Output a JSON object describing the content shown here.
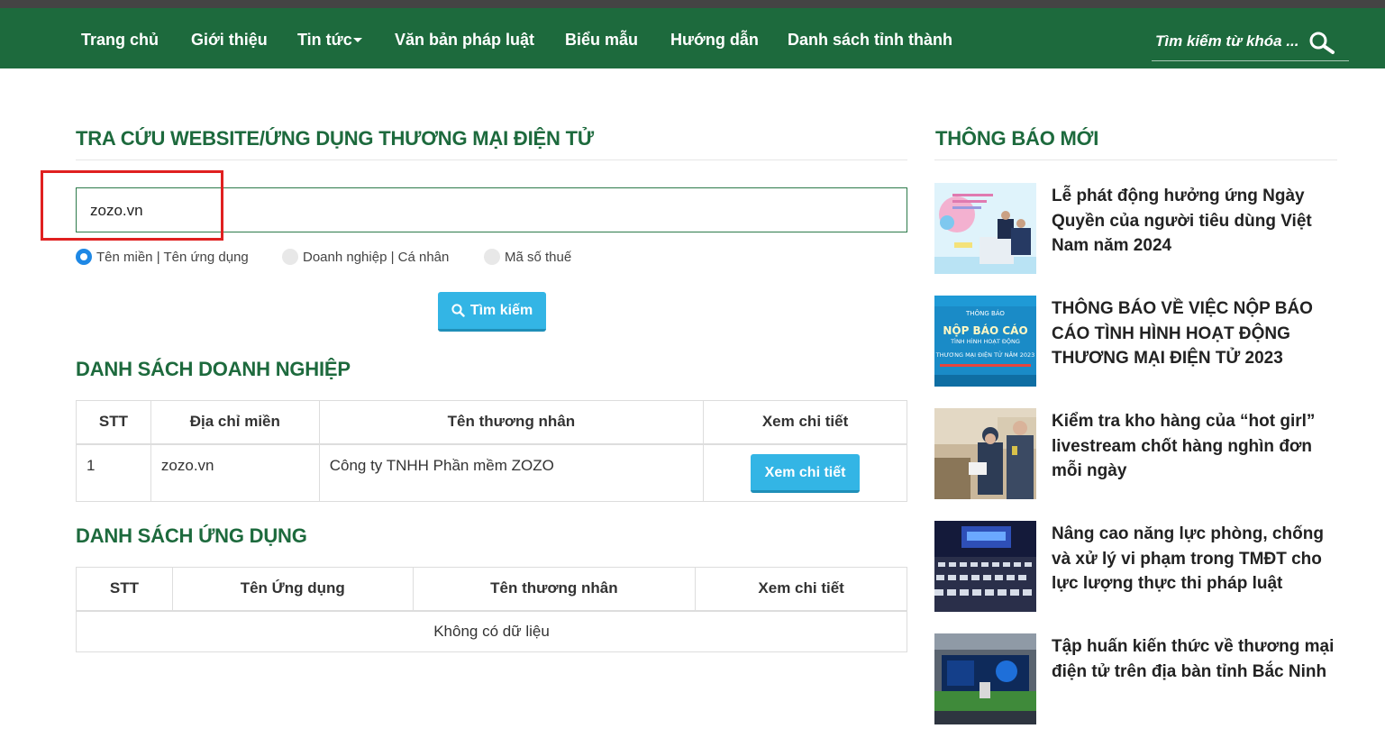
{
  "nav": {
    "items": [
      {
        "label": "Trang chủ"
      },
      {
        "label": "Giới thiệu"
      },
      {
        "label": "Tin tức"
      },
      {
        "label": "Văn bản pháp luật"
      },
      {
        "label": "Biểu mẫu"
      },
      {
        "label": "Hướng dẫn"
      },
      {
        "label": "Danh sách tỉnh thành"
      }
    ],
    "search_placeholder": "Tìm kiếm từ khóa ..."
  },
  "lookup": {
    "title": "TRA CỨU WEBSITE/ỨNG DỤNG THƯƠNG MẠI ĐIỆN TỬ",
    "query": "zozo.vn",
    "options": [
      {
        "label": "Tên miền | Tên ứng dụng",
        "selected": true
      },
      {
        "label": "Doanh nghiệp | Cá nhân",
        "selected": false
      },
      {
        "label": "Mã số thuế",
        "selected": false
      }
    ],
    "search_button": "Tìm kiếm"
  },
  "businesses": {
    "title": "DANH SÁCH DOANH NGHIỆP",
    "columns": [
      "STT",
      "Địa chỉ miền",
      "Tên thương nhân",
      "Xem chi tiết"
    ],
    "rows": [
      {
        "stt": "1",
        "domain": "zozo.vn",
        "merchant": "Công ty TNHH Phần mềm ZOZO",
        "action": "Xem chi tiết"
      }
    ]
  },
  "apps": {
    "title": "DANH SÁCH ỨNG DỤNG",
    "columns": [
      "STT",
      "Tên Ứng dụng",
      "Tên thương nhân",
      "Xem chi tiết"
    ],
    "empty_text": "Không có dữ liệu"
  },
  "notices": {
    "title": "THÔNG BÁO MỚI",
    "items": [
      {
        "title": "Lễ phát động hưởng ứng Ngày Quyền của người tiêu dùng Việt Nam năm 2024"
      },
      {
        "title": "THÔNG BÁO VỀ VIỆC NỘP BÁO CÁO TÌNH HÌNH HOẠT ĐỘNG THƯƠNG MẠI ĐIỆN TỬ 2023",
        "thumb_text": {
          "top": "THÔNG BÁO",
          "main": "NỘP BÁO CÁO",
          "sub": "TÌNH HÌNH HOẠT ĐỘNG",
          "line": "THƯƠNG MẠI ĐIỆN TỬ NĂM 2023"
        }
      },
      {
        "title": "Kiểm tra kho hàng của “hot girl” livestream chốt hàng nghìn đơn mỗi ngày"
      },
      {
        "title": "Nâng cao năng lực phòng, chống và xử lý vi phạm trong TMĐT cho lực lượng thực thi pháp luật"
      },
      {
        "title": "Tập huấn kiến thức về thương mại điện tử trên địa bàn tỉnh Bắc Ninh"
      }
    ]
  },
  "colors": {
    "brand": "#1d6a3d",
    "accent": "#33b5e5",
    "highlight": "#e02020",
    "empty": "#a94442"
  }
}
